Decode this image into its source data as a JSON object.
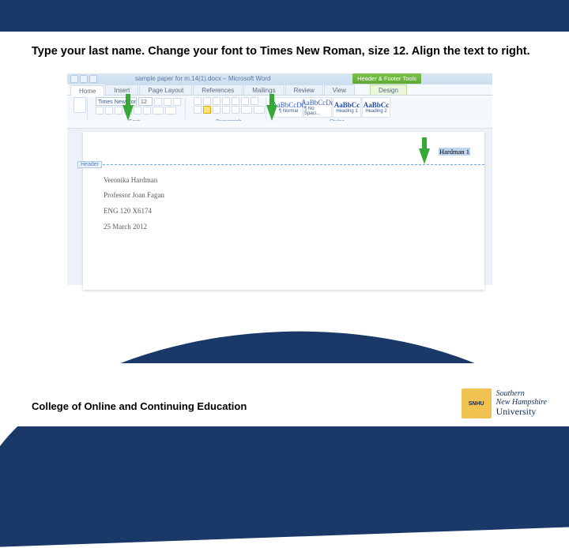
{
  "instruction": "Type your last name. Change your font to Times New Roman, size 12. Align the text to right.",
  "word": {
    "title": "sample paper for m.14(1).docx – Microsoft Word",
    "context_tab": "Header & Footer Tools",
    "tabs": {
      "home": "Home",
      "insert": "Insert",
      "page_layout": "Page Layout",
      "references": "References",
      "mailings": "Mailings",
      "review": "Review",
      "view": "View",
      "design": "Design"
    },
    "ribbon": {
      "font_name": "Times New Rom…",
      "font_size": "12",
      "group_font": "Font",
      "group_paragraph": "Paragraph",
      "group_styles": "Styles",
      "styles": {
        "normal": {
          "sample": "AaBbCcDc",
          "label": "¶ Normal"
        },
        "nospacing": {
          "sample": "AaBbCcDc",
          "label": "¶ No Spaci..."
        },
        "heading1": {
          "sample": "AaBbCc",
          "label": "Heading 1"
        },
        "heading2": {
          "sample": "AaBbCc",
          "label": "Heading 2"
        }
      }
    },
    "header": {
      "tag": "Header",
      "text": "Hardman 1"
    },
    "body": {
      "line1": "Veronika Hardman",
      "line2": "Professor Joan Fagan",
      "line3": "ENG 120 X6174",
      "line4": "25 March 2012"
    }
  },
  "footer": {
    "text": "College of Online and Continuing Education",
    "logo": {
      "top": "Southern",
      "mid": "New Hampshire",
      "bot": "University"
    }
  }
}
